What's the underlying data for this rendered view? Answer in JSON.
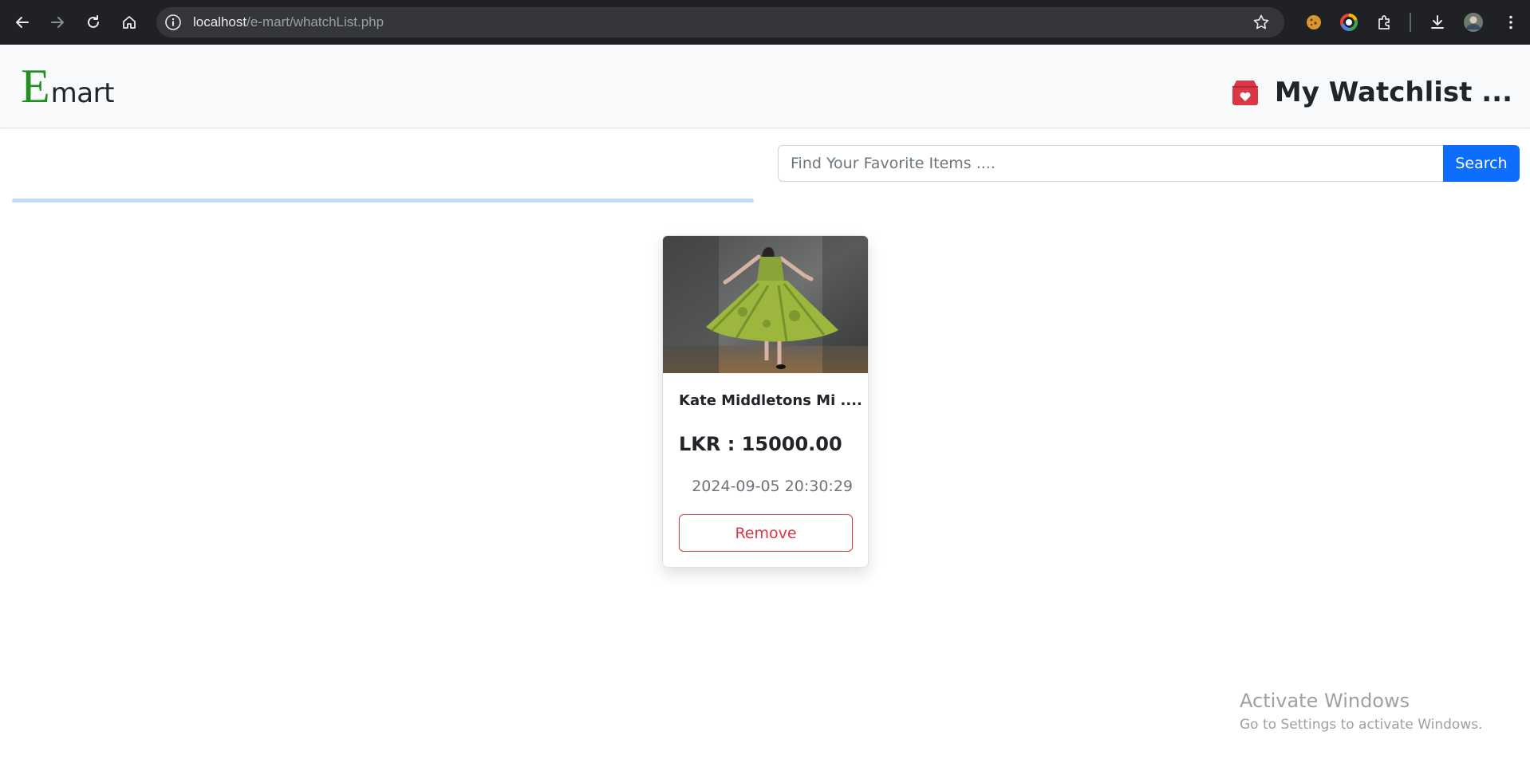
{
  "browser": {
    "url_host": "localhost",
    "url_path": "/e-mart/whatchList.php"
  },
  "navbar": {
    "brand_first": "E",
    "brand_rest": "mart",
    "title": "My Watchlist ...",
    "title_icon": "heart-box-icon",
    "accent_color": "#dc3545",
    "brand_color": "#1f8f1f"
  },
  "search": {
    "placeholder": "Find Your Favorite Items ....",
    "button_label": "Search",
    "button_color": "#0d6efd"
  },
  "items": [
    {
      "name": "Kate Middletons Mi ....",
      "price": "LKR : 15000.00",
      "date": "2024-09-05 20:30:29",
      "remove_label": "Remove",
      "image": "green-dress-photo"
    }
  ],
  "watermark": {
    "line1": "Activate Windows",
    "line2": "Go to Settings to activate Windows."
  }
}
